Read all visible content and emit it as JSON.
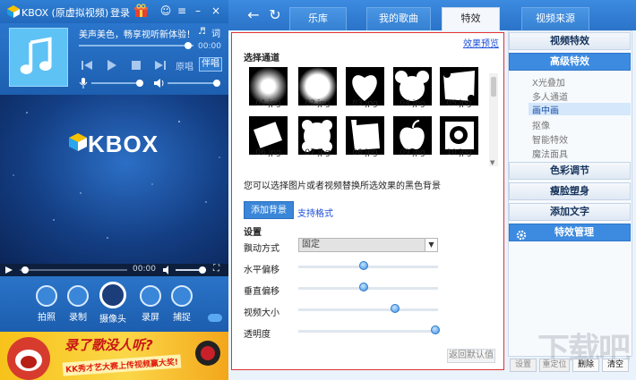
{
  "left": {
    "title": "KBOX (原虚拟视频)",
    "login": "登录",
    "song_text": "美声美色，畅享视听新体验！",
    "time_top": "00:00",
    "orig_label": "原唱",
    "accomp_label": "伴唱",
    "video_time": "00:00",
    "kbox_text": "KBOX",
    "tools": [
      {
        "label": "拍照"
      },
      {
        "label": "录制"
      },
      {
        "label": "摄像头"
      },
      {
        "label": "录屏"
      },
      {
        "label": "捕捉"
      }
    ],
    "banner_line1": "录了歌没人听?",
    "banner_line2": "KK秀才艺大赛上传视频赢大奖!",
    "lyrics_btn": "词"
  },
  "nav": {
    "tabs": [
      "乐库",
      "我的歌曲",
      "特效",
      "视频来源"
    ],
    "active_tab": "特效"
  },
  "effects": {
    "preview_link": "效果预览",
    "choose_channel": "选择通道",
    "thumbs_row1": [
      "01.jpg",
      "02.jpg",
      "03.jpg",
      "04.jpg",
      "05.jpg"
    ],
    "thumbs_row2": [
      "06.jpg",
      "07.jpg",
      "08.jpg",
      "09.jpg",
      "10.jpg"
    ],
    "help_text": "您可以选择图片或者视频替换所选效果的黑色背景",
    "add_bg": "添加背景",
    "support_format": "支持格式",
    "settings_label": "设置",
    "float_mode_label": "飘动方式",
    "float_mode_value": "固定",
    "h_offset_label": "水平偏移",
    "v_offset_label": "垂直偏移",
    "video_size_label": "视频大小",
    "opacity_label": "透明度",
    "h_offset_pct": 0.47,
    "v_offset_pct": 0.47,
    "video_size_pct": 0.69,
    "opacity_pct": 0.98,
    "reset_default": "返回默认值"
  },
  "sidebar": {
    "video_effects": "视频特效",
    "advanced_effects": "高级特效",
    "subs": [
      "X光叠加",
      "多人通道",
      "画中画",
      "抠像",
      "智能特效",
      "魔法面具"
    ],
    "selected_sub": "画中画",
    "color_adjust": "色彩调节",
    "face_body": "瘦脸塑身",
    "add_text": "添加文字",
    "effect_manage": "特效管理"
  },
  "bottom_buttons": [
    "设置",
    "重定位",
    "删除",
    "清空"
  ],
  "watermark": "下载吧"
}
